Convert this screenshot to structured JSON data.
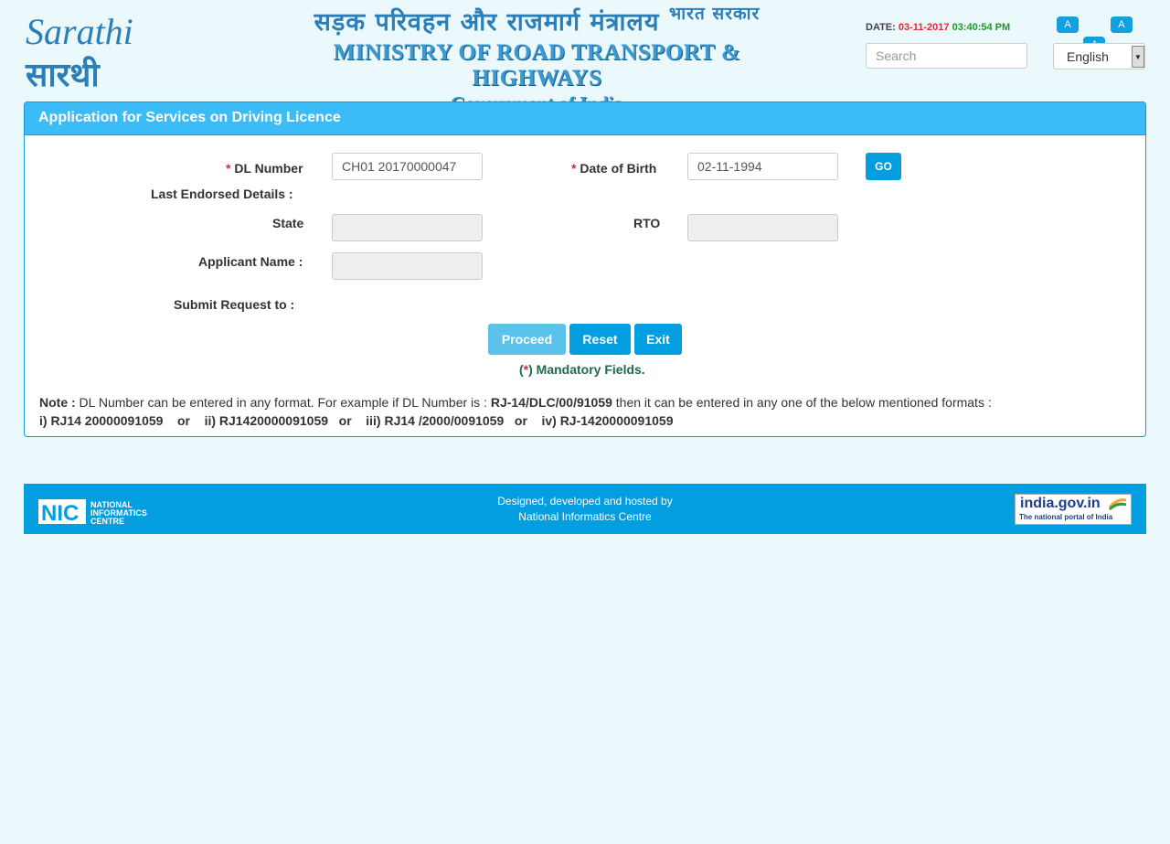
{
  "header": {
    "logo_english": "Sarathi",
    "logo_hindi": "सारथी",
    "ministry_hindi": "सड़क परिवहन और राजमार्ग मंत्रालय",
    "govt_hindi": "भारत सरकार",
    "ministry_english": "MINISTRY OF ROAD TRANSPORT & HIGHWAYS",
    "govt_english": "Government of India",
    "date_label": "DATE:",
    "date_value": "03-11-2017",
    "time_value": "03:40:54 PM",
    "font_decrease": "A",
    "font_normal": "A",
    "font_increase": "A",
    "search_placeholder": "Search",
    "language": "English"
  },
  "panel": {
    "title": "Application for Services on Driving Licence",
    "dl_label": "DL Number",
    "dl_value": "CH01 20170000047",
    "dob_label": "Date of Birth",
    "dob_value": "02-11-1994",
    "go_label": "GO",
    "last_endorsed_label": "Last Endorsed Details :",
    "state_label": "State",
    "rto_label": "RTO",
    "applicant_label": "Applicant Name :",
    "submit_label": "Submit Request to :",
    "proceed_label": "Proceed",
    "reset_label": "Reset",
    "exit_label": "Exit",
    "mandatory_open": "(",
    "mandatory_star": "*",
    "mandatory_text": ") Mandatory Fields.",
    "note_label": "Note :",
    "note_text1": " DL Number can be entered in any format. For example if DL Number is : ",
    "note_example": "RJ-14/DLC/00/91059",
    "note_text2": " then it can be entered in any one of the below mentioned formats :",
    "formats_line": "i) RJ14 20000091059    or    ii) RJ1420000091059   or    iii) RJ14 /2000/0091059   or    iv) RJ-1420000091059"
  },
  "footer": {
    "nic_short": "NIC",
    "nic_line1": "NATIONAL",
    "nic_line2": "INFORMATICS",
    "nic_line3": "CENTRE",
    "line1": "Designed, developed and hosted by",
    "line2": "National Informatics Centre",
    "igov_title": "india.gov.in",
    "igov_sub": "The national portal of India"
  },
  "colors": {
    "panel_header": "#3cbcf6",
    "button": "#029ee0",
    "required": "#e8272b",
    "footer": "#029ee0"
  }
}
